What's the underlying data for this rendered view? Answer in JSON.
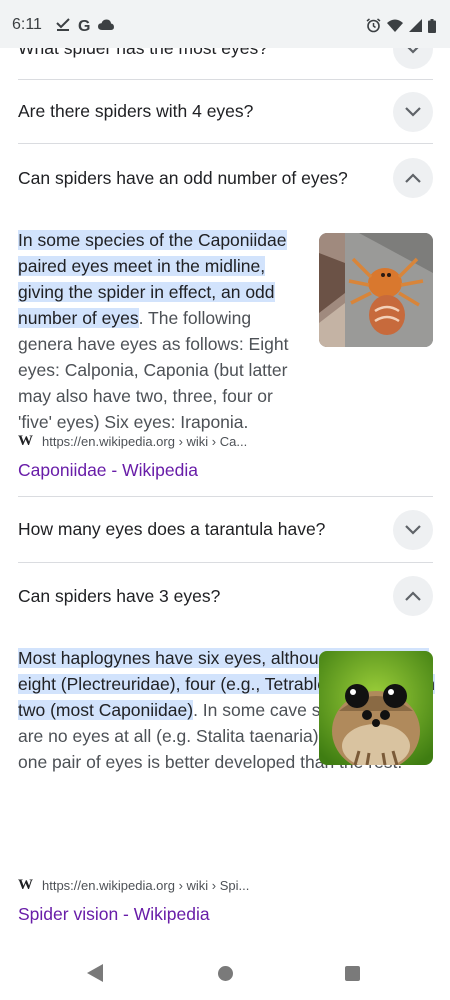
{
  "status_bar": {
    "time": "6:11",
    "left_icons": [
      "check-download-icon",
      "google-g-icon",
      "cloud-icon"
    ],
    "google_letter": "G",
    "right_icons": [
      "alarm-icon",
      "wifi-icon",
      "signal-icon",
      "battery-icon"
    ]
  },
  "faq": {
    "q0": "What spider has the most eyes?",
    "q1": "Are there spiders with 4 eyes?",
    "q2": "Can spiders have an odd number of eyes?",
    "a2": {
      "highlight": "In some species of the Caponiidae paired eyes meet in the midline, giving the spider in effect, an odd number of eyes",
      "rest": ". The following genera have eyes as follows: Eight eyes: Calponia, Caponia (but latter may also have two, three, four or 'five' eyes) Six eyes: Iraponia.",
      "source_url": "https://en.wikipedia.org › wiki › Ca...",
      "source_title": "Caponiidae - Wikipedia"
    },
    "q3": "How many eyes does a tarantula have?",
    "q4": "Can spiders have 3 eyes?",
    "a4": {
      "highlight": "Most haplogynes have six eyes, although some have eight (Plectreuridae), four (e.g., Tetrablemma) or even two (most Caponiidae)",
      "rest": ". In some cave species, there are no eyes at all (e.g. Stalita taenaria). Sometimes one pair of eyes is better developed than the rest.",
      "source_url": "https://en.wikipedia.org › wiki › Spi...",
      "source_title": "Spider vision - Wikipedia"
    }
  },
  "wiki_logo": "W",
  "colors": {
    "highlight": "#d2e3fc",
    "link": "#681da8",
    "chevron_bg": "#eef0f2"
  },
  "nav_bar": [
    "back-icon",
    "home-icon",
    "recents-icon"
  ]
}
